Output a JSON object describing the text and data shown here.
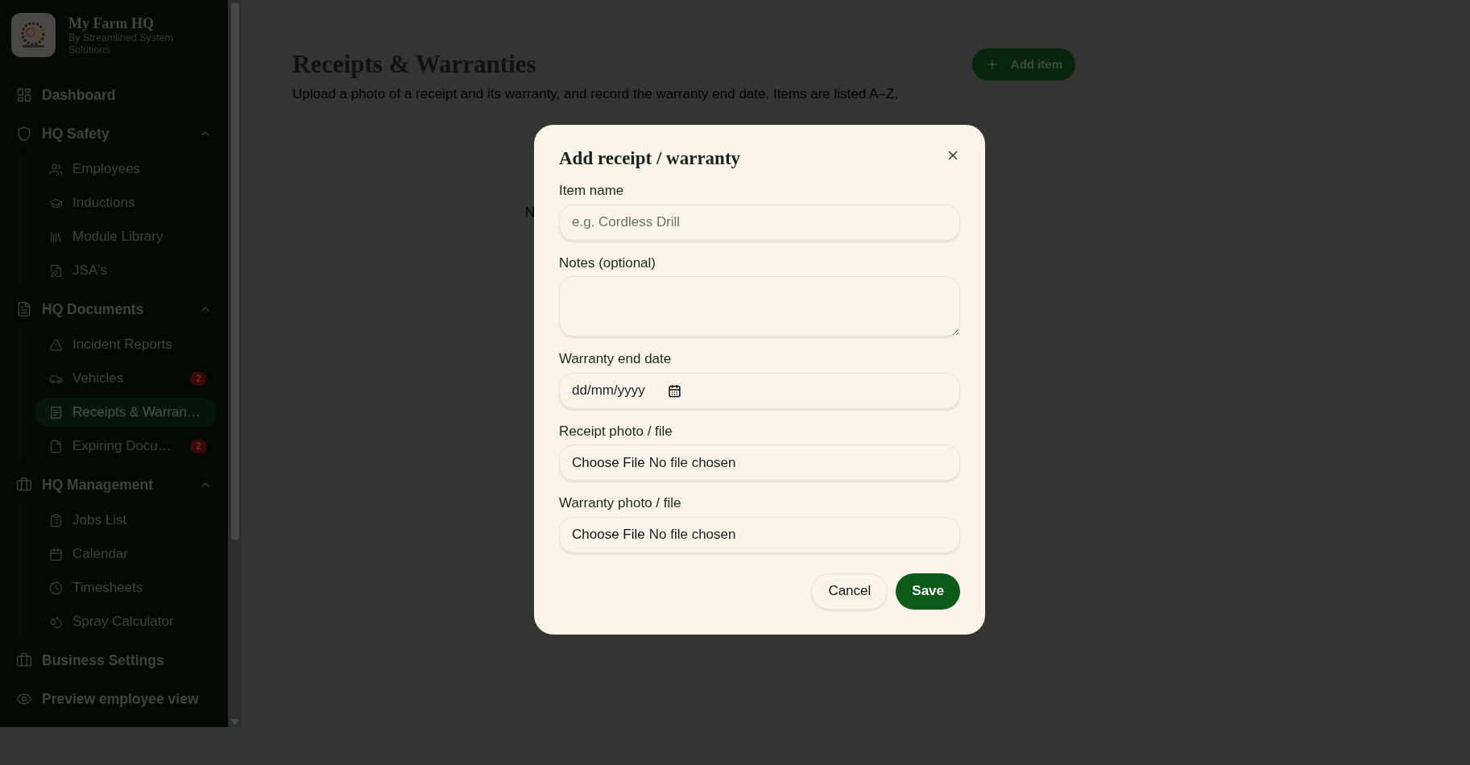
{
  "sidebar": {
    "brand": {
      "title": "My Farm HQ",
      "subtitle": "By Streamlined System Solutions"
    },
    "items": [
      {
        "label": "Dashboard",
        "selected": false
      },
      {
        "label": "HQ Safety",
        "selected": false,
        "expanded": true,
        "children": [
          {
            "label": "Employees",
            "selected": false
          },
          {
            "label": "Inductions",
            "selected": false
          },
          {
            "label": "Module Library",
            "selected": false
          },
          {
            "label": "JSA's",
            "selected": false
          }
        ]
      },
      {
        "label": "HQ Documents",
        "selected": false,
        "expanded": true,
        "children": [
          {
            "label": "Incident Reports",
            "selected": false
          },
          {
            "label": "Vehicles",
            "selected": false,
            "badge": "2"
          },
          {
            "label": "Receipts & Warran…",
            "selected": true
          },
          {
            "label": "Expiring Docu…",
            "selected": false,
            "badge": "2"
          }
        ]
      },
      {
        "label": "HQ Management",
        "selected": false,
        "expanded": true,
        "children": [
          {
            "label": "Jobs List",
            "selected": false
          },
          {
            "label": "Calendar",
            "selected": false
          },
          {
            "label": "Timesheets",
            "selected": false
          },
          {
            "label": "Spray Calculator",
            "selected": false
          }
        ]
      },
      {
        "label": "Business Settings",
        "selected": false
      },
      {
        "label": "Preview employee view",
        "selected": false
      }
    ]
  },
  "page": {
    "title": "Receipts & Warranties",
    "subtitle": "Upload a photo of a receipt and its warranty, and record the warranty end date. Items are listed A–Z.",
    "add_button": "Add item",
    "panel_text": "N"
  },
  "dialog": {
    "title": "Add receipt / warranty",
    "fields": [
      {
        "kind": "text",
        "label": "Item name",
        "placeholder": "e.g. Cordless Drill"
      },
      {
        "kind": "textarea",
        "label": "Notes (optional)"
      },
      {
        "kind": "date",
        "label": "Warranty end date",
        "placeholder": "dd/mm/yyyy"
      },
      {
        "kind": "file",
        "label": "Receipt photo / file",
        "button": "Choose File",
        "status": "No file chosen"
      },
      {
        "kind": "file",
        "label": "Warranty photo / file",
        "button": "Choose File",
        "status": "No file chosen"
      }
    ],
    "buttons": [
      {
        "label": "Cancel",
        "kind": "secondary"
      },
      {
        "label": "Save",
        "kind": "primary"
      }
    ]
  }
}
